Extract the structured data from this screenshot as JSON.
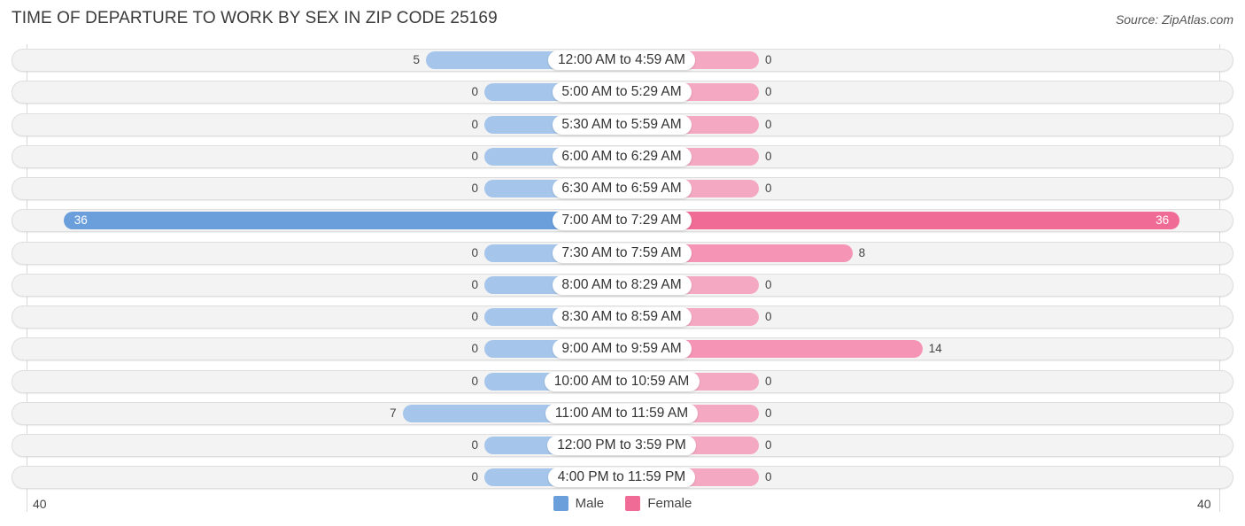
{
  "title": "TIME OF DEPARTURE TO WORK BY SEX IN ZIP CODE 25169",
  "source": "Source: ZipAtlas.com",
  "colors": {
    "male": "#a5c6ea",
    "male_highlight": "#6a9fdc",
    "female": "#f4a8c1",
    "female_highlight": "#f06b96",
    "legend_male": "#6a9fdc",
    "legend_female": "#f06b96"
  },
  "legend": {
    "male": "Male",
    "female": "Female"
  },
  "axis": {
    "left_tick": "40",
    "right_tick": "40"
  },
  "chart_data": {
    "type": "bar",
    "orientation": "horizontal-diverging",
    "title": "TIME OF DEPARTURE TO WORK BY SEX IN ZIP CODE 25169",
    "xlim": [
      -40,
      40
    ],
    "legend_position": "bottom",
    "categories": [
      "12:00 AM to 4:59 AM",
      "5:00 AM to 5:29 AM",
      "5:30 AM to 5:59 AM",
      "6:00 AM to 6:29 AM",
      "6:30 AM to 6:59 AM",
      "7:00 AM to 7:29 AM",
      "7:30 AM to 7:59 AM",
      "8:00 AM to 8:29 AM",
      "8:30 AM to 8:59 AM",
      "9:00 AM to 9:59 AM",
      "10:00 AM to 10:59 AM",
      "11:00 AM to 11:59 AM",
      "12:00 PM to 3:59 PM",
      "4:00 PM to 11:59 PM"
    ],
    "series": [
      {
        "name": "Male",
        "values": [
          5,
          0,
          0,
          0,
          0,
          36,
          0,
          0,
          0,
          0,
          0,
          7,
          0,
          0
        ]
      },
      {
        "name": "Female",
        "values": [
          0,
          0,
          0,
          0,
          0,
          36,
          8,
          0,
          0,
          14,
          0,
          0,
          0,
          0
        ]
      }
    ]
  }
}
